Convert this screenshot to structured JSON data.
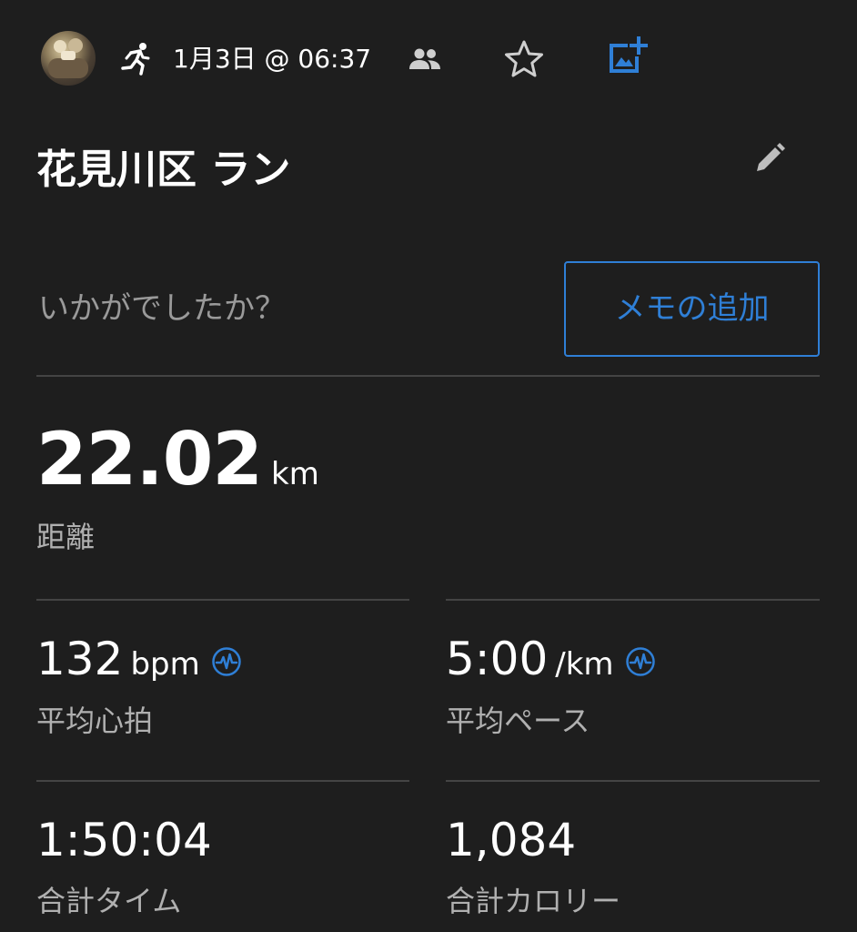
{
  "header": {
    "activity_icon": "running-icon",
    "date_time": "1月3日 @ 06:37",
    "icons": [
      "people-icon",
      "star-icon",
      "add-photo-icon"
    ],
    "accent_color": "#2f7fd6"
  },
  "activity": {
    "title": "花見川区 ラン",
    "edit_icon": "pencil-icon"
  },
  "note": {
    "prompt": "いかがでしたか？",
    "button_label": "メモの追加"
  },
  "distance": {
    "value": "22.02",
    "unit": "km",
    "label": "距離"
  },
  "stats": {
    "heart_rate": {
      "value": "132",
      "unit": "bpm",
      "label": "平均心拍",
      "icon": "pulse-icon"
    },
    "pace": {
      "value": "5:00",
      "unit": "/km",
      "label": "平均ペース",
      "icon": "pulse-icon"
    },
    "total_time": {
      "value": "1:50:04",
      "label": "合計タイム"
    },
    "calories": {
      "value": "1,084",
      "label": "合計カロリー"
    }
  }
}
